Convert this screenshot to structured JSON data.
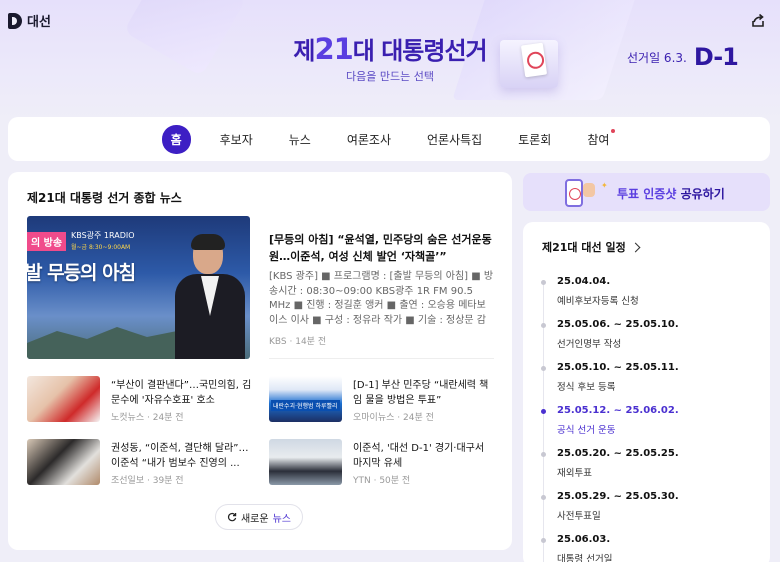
{
  "header": {
    "logo_text": "대선",
    "title_prefix": "제",
    "title_number": "21",
    "title_suffix": "대 대통령선거",
    "subtitle": "다음을 만드는 선택",
    "election_day_label": "선거일 6.3.",
    "dday": "D-1"
  },
  "nav": {
    "items": [
      "홈",
      "후보자",
      "뉴스",
      "여론조사",
      "언론사특집",
      "토론회",
      "참여"
    ]
  },
  "news": {
    "section_title": "제21대 대통령 선거 종합 뉴스",
    "featured": {
      "image_badge": "의 방송",
      "image_channel": "KBS광주 1RADIO",
      "image_time": "월~금 8:30~9:00AM",
      "image_title": "발 무등의 아침",
      "headline": "[무등의 아침] “윤석열, 민주당의 숨은 선거운동원…이준석, 여성 신체 발언 ‘자책골’”",
      "body": "[KBS 광주] ■ 프로그램명 : [출발 무등의 아침] ■ 방송시간 : 08:30~09:00 KBS광주 1R FM 90.5 MHz ■ 진행 : 정길훈 앵커 ■ 출연 : 오승용 메타보이스 이사 ■ 구성 : 정유라 작가 ■ 기술 : 정상문 감독 ▶유...",
      "source": "KBS",
      "time": "14분 전"
    },
    "items": [
      {
        "title": "“부산이 결판낸다”…국민의힘, 김문수에 '자유수호표' 호소",
        "source": "노컷뉴스",
        "time": "24분 전"
      },
      {
        "title": "[D-1] 부산 민주당 “내란세력 책임 물을 방법은 투표”",
        "source": "오마이뉴스",
        "time": "24분 전",
        "thumb_label": "내란수괴·현행범 하루빨리"
      },
      {
        "title": "권성동, “이준석, 결단해 달라”…이준석 “내가 범보수 진영의 ...",
        "source": "조선일보",
        "time": "39분 전"
      },
      {
        "title": "이준석, '대선 D-1' 경기·대구서 마지막 유세",
        "source": "YTN",
        "time": "50분 전"
      }
    ],
    "more_label": "새로운",
    "more_highlight": "뉴스"
  },
  "share_banner": {
    "text": "투표 인증샷",
    "text_suffix": "공유하기"
  },
  "schedule": {
    "title": "제21대 대선 일정",
    "events": [
      {
        "date": "25.04.04.",
        "name": "예비후보자등록 신청",
        "current": false
      },
      {
        "date": "25.05.06. ~ 25.05.10.",
        "name": "선거인명부 작성",
        "current": false
      },
      {
        "date": "25.05.10. ~ 25.05.11.",
        "name": "정식 후보 등록",
        "current": false
      },
      {
        "date": "25.05.12. ~ 25.06.02.",
        "name": "공식 선거 운동",
        "current": true
      },
      {
        "date": "25.05.20. ~ 25.05.25.",
        "name": "재외투표",
        "current": false
      },
      {
        "date": "25.05.29. ~ 25.05.30.",
        "name": "사전투표일",
        "current": false
      },
      {
        "date": "25.06.03.",
        "name": "대통령 선거일",
        "current": false
      }
    ]
  },
  "colors": {
    "accent": "#3d1fc4",
    "current_event": "#4a30d0",
    "background": "#efeef8"
  }
}
